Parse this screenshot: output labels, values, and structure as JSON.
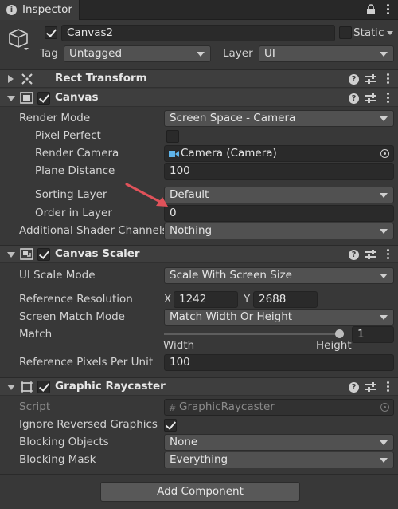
{
  "window": {
    "tab_title": "Inspector"
  },
  "gameobject": {
    "name": "Canvas2",
    "static_label": "Static",
    "tag_label": "Tag",
    "tag_value": "Untagged",
    "layer_label": "Layer",
    "layer_value": "UI"
  },
  "rect_transform": {
    "title": "Rect Transform"
  },
  "canvas": {
    "title": "Canvas",
    "render_mode_label": "Render Mode",
    "render_mode_value": "Screen Space - Camera",
    "pixel_perfect_label": "Pixel Perfect",
    "render_camera_label": "Render Camera",
    "render_camera_value": "Camera (Camera)",
    "plane_distance_label": "Plane Distance",
    "plane_distance_value": "100",
    "sorting_layer_label": "Sorting Layer",
    "sorting_layer_value": "Default",
    "order_in_layer_label": "Order in Layer",
    "order_in_layer_value": "0",
    "shader_channels_label": "Additional Shader Channels",
    "shader_channels_value": "Nothing"
  },
  "canvas_scaler": {
    "title": "Canvas Scaler",
    "ui_scale_mode_label": "UI Scale Mode",
    "ui_scale_mode_value": "Scale With Screen Size",
    "ref_resolution_label": "Reference Resolution",
    "x_label": "X",
    "x_value": "1242",
    "y_label": "Y",
    "y_value": "2688",
    "screen_match_label": "Screen Match Mode",
    "screen_match_value": "Match Width Or Height",
    "match_label": "Match",
    "match_value": "1",
    "match_fraction": 1,
    "width_label": "Width",
    "height_label": "Height",
    "ref_ppu_label": "Reference Pixels Per Unit",
    "ref_ppu_value": "100"
  },
  "graphic_raycaster": {
    "title": "Graphic Raycaster",
    "script_label": "Script",
    "script_value": "GraphicRaycaster",
    "ignore_reversed_label": "Ignore Reversed Graphics",
    "blocking_objects_label": "Blocking Objects",
    "blocking_objects_value": "None",
    "blocking_mask_label": "Blocking Mask",
    "blocking_mask_value": "Everything"
  },
  "footer": {
    "add_component_label": "Add Component"
  },
  "colors": {
    "annotation_arrow": "#e0525a",
    "background": "#383838",
    "field": "#2a2a2a"
  },
  "icons": [
    "inspector-tab-icon",
    "lock-icon",
    "kebab-menu-icon",
    "gameobject-cube-icon",
    "rect-transform-icon",
    "canvas-icon",
    "canvas-scaler-icon",
    "graphic-raycaster-icon",
    "help-icon",
    "preset-sliders-icon",
    "camera-icon",
    "object-picker-icon",
    "script-icon"
  ]
}
